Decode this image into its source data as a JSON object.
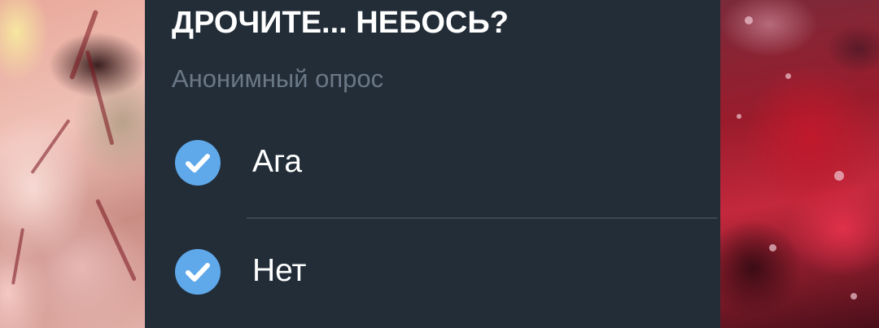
{
  "poll": {
    "question": "ДРОЧИТЕ... НЕБОСЬ?",
    "type_label": "Анонимный опрос",
    "options": [
      {
        "label": "Ага",
        "selected": true,
        "icon": "check-circle-icon"
      },
      {
        "label": "Нет",
        "selected": true,
        "icon": "check-circle-icon"
      }
    ]
  },
  "colors": {
    "card_background": "#222d38",
    "accent_check": "#5fa8ea",
    "secondary_text": "#6b7885",
    "divider": "#3a4754"
  }
}
